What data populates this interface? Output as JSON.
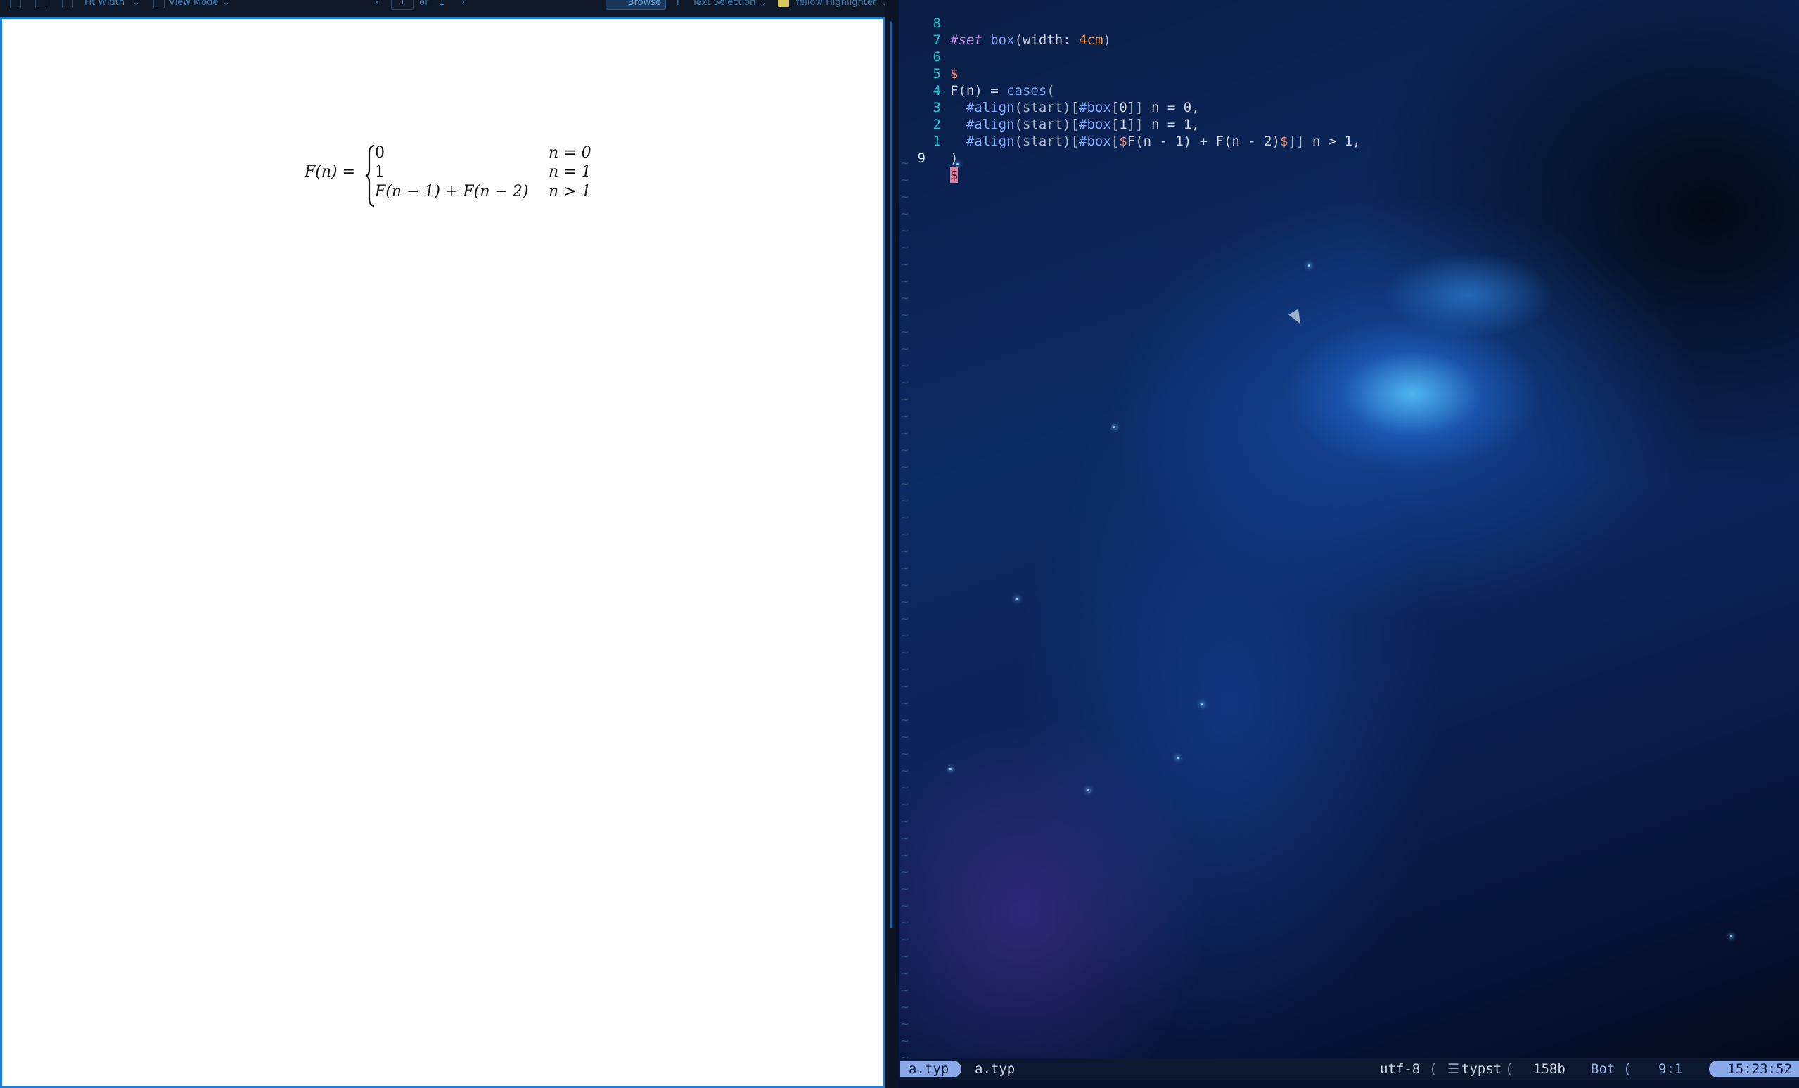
{
  "viewer": {
    "toolbar": {
      "zoom_mode": "Fit Width",
      "view_mode": "View Mode",
      "current_page": "1",
      "page_of": "of",
      "page_total": "1",
      "browse": "Browse",
      "text_selection": "Text Selection",
      "highlighter": "Yellow Highlighter"
    },
    "equation": {
      "lhs": "F(n) =",
      "cases": [
        {
          "value": "0",
          "condition": "n = 0"
        },
        {
          "value": "1",
          "condition": "n = 1"
        },
        {
          "value": "F(n − 1) + F(n − 2)",
          "condition": "n > 1"
        }
      ]
    }
  },
  "editor": {
    "lines": [
      {
        "num": "8",
        "code": "#set box(width: 4cm)"
      },
      {
        "num": "7",
        "code": ""
      },
      {
        "num": "6",
        "code": "$"
      },
      {
        "num": "5",
        "code": "F(n) = cases("
      },
      {
        "num": "4",
        "code": "  #align(start)[#box[0]] n = 0,"
      },
      {
        "num": "3",
        "code": "  #align(start)[#box[1]] n = 1,"
      },
      {
        "num": "2",
        "code": "  #align(start)[#box[$F(n - 1) + F(n - 2)$]] n > 1,"
      },
      {
        "num": "1",
        "code": ")"
      },
      {
        "num": "9",
        "code": "$"
      }
    ],
    "filler": "~"
  },
  "statusline": {
    "mode_file": "a.typ",
    "file": "a.typ",
    "encoding": "utf-8",
    "filetype": "typst",
    "size": "158b",
    "scroll": "Bot",
    "position": "9:1",
    "clock": "15:23:52"
  },
  "colors": {
    "accent": "#1a7ad4",
    "line_numbers": "#18c7d8",
    "statusline_mode": "#8aa9e8",
    "cursor": "#e07a9a"
  }
}
